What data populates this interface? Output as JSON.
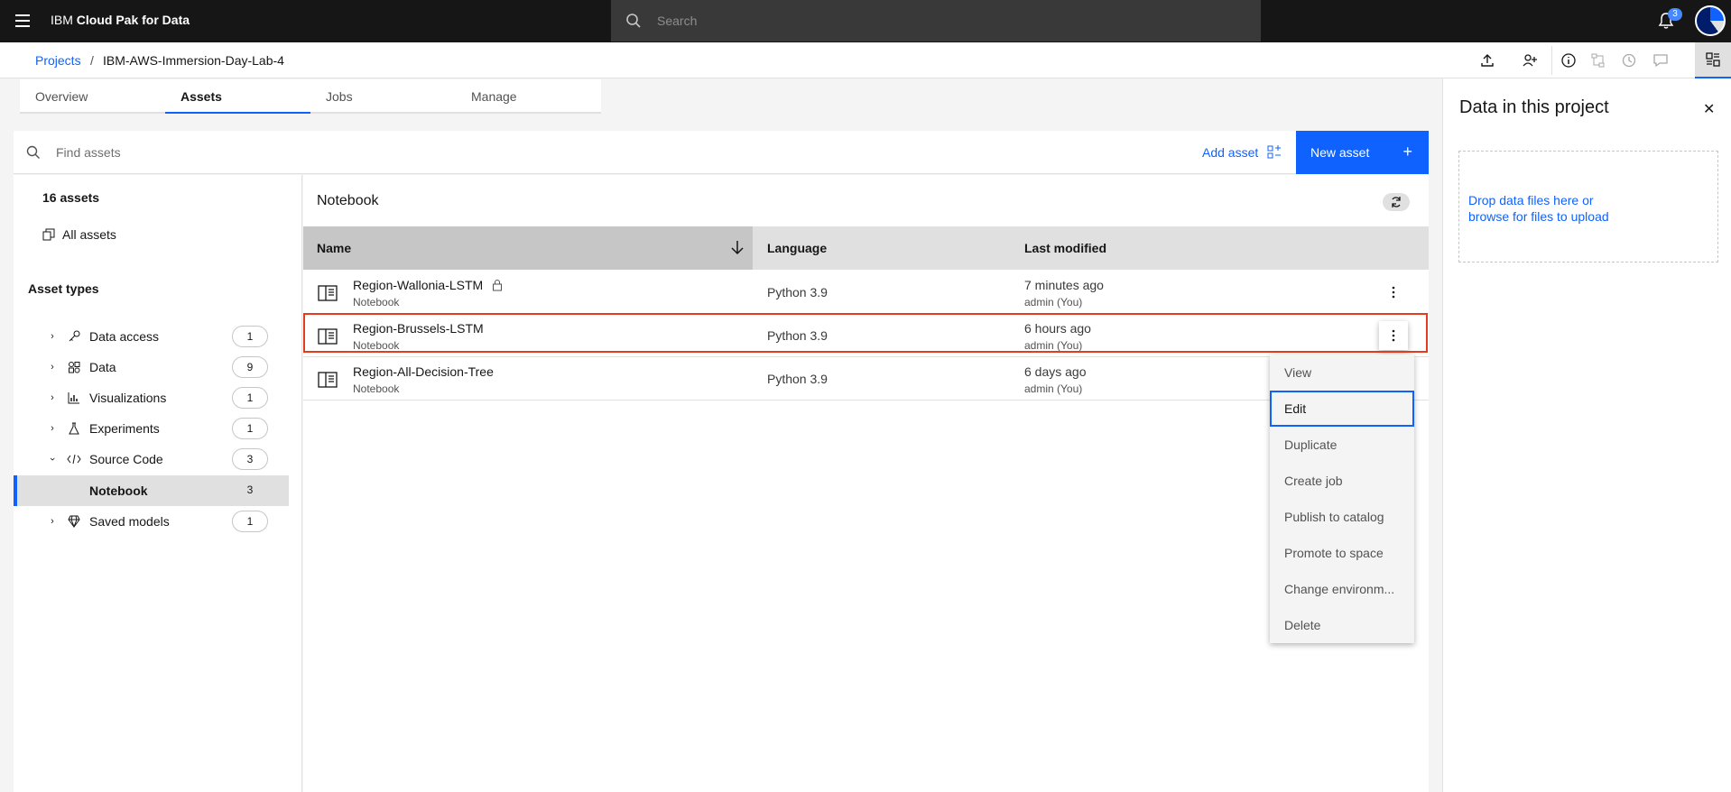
{
  "topbar": {
    "brand_prefix": "IBM",
    "brand_name": "Cloud Pak for Data",
    "search_placeholder": "Search",
    "notification_count": "3"
  },
  "breadcrumb": {
    "projects": "Projects",
    "separator": "/",
    "current": "IBM-AWS-Immersion-Day-Lab-4"
  },
  "tabs": [
    {
      "label": "Overview"
    },
    {
      "label": "Assets"
    },
    {
      "label": "Jobs"
    },
    {
      "label": "Manage"
    }
  ],
  "toolbar": {
    "find_placeholder": "Find assets",
    "add_asset": "Add asset",
    "new_asset": "New asset"
  },
  "sidebar": {
    "asset_count": "16 assets",
    "all_assets": "All assets",
    "asset_types_heading": "Asset types",
    "items": [
      {
        "label": "Data access",
        "count": "1",
        "icon": "key-icon"
      },
      {
        "label": "Data",
        "count": "9",
        "icon": "data-icon"
      },
      {
        "label": "Visualizations",
        "count": "1",
        "icon": "chart-icon"
      },
      {
        "label": "Experiments",
        "count": "1",
        "icon": "flask-icon"
      },
      {
        "label": "Source Code",
        "count": "3",
        "icon": "code-icon"
      },
      {
        "label": "Notebook",
        "count": "3"
      },
      {
        "label": "Saved models",
        "count": "1",
        "icon": "model-icon"
      }
    ]
  },
  "notebook": {
    "title": "Notebook",
    "columns": {
      "name": "Name",
      "language": "Language",
      "modified": "Last modified"
    },
    "rows": [
      {
        "name": "Region-Wallonia-LSTM",
        "type": "Notebook",
        "language": "Python 3.9",
        "modified": "7 minutes ago",
        "by": "admin (You)",
        "locked": true
      },
      {
        "name": "Region-Brussels-LSTM",
        "type": "Notebook",
        "language": "Python 3.9",
        "modified": "6 hours ago",
        "by": "admin (You)"
      },
      {
        "name": "Region-All-Decision-Tree",
        "type": "Notebook",
        "language": "Python 3.9",
        "modified": "6 days ago",
        "by": "admin (You)"
      }
    ]
  },
  "context_menu": {
    "items": [
      "View",
      "Edit",
      "Duplicate",
      "Create job",
      "Publish to catalog",
      "Promote to space",
      "Change environm...",
      "Delete"
    ],
    "focused": "Edit"
  },
  "right_panel": {
    "title": "Data in this project",
    "drop_line1": "Drop data files here or",
    "drop_line2": "browse for files to upload"
  },
  "colors": {
    "accent": "#0f62fe",
    "highlight": "#e43d1e",
    "topbar": "#161616"
  }
}
